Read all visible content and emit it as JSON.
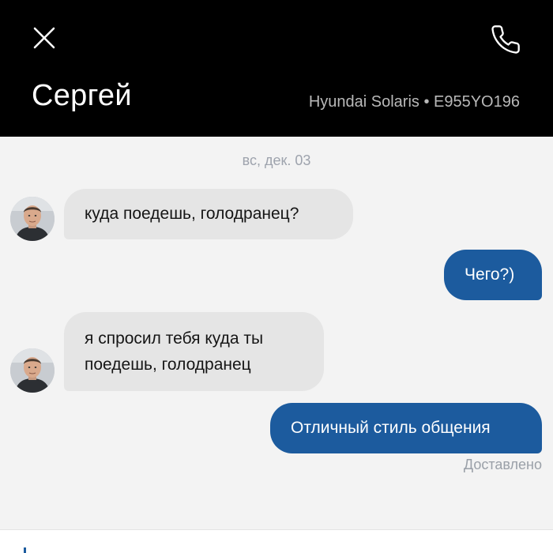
{
  "header": {
    "driver_name": "Сергей",
    "car_info": "Hyundai Solaris • E955YO196",
    "close_icon": "close-icon",
    "call_icon": "phone-icon"
  },
  "chat": {
    "date": "вс, дек. 03",
    "messages": [
      {
        "direction": "incoming",
        "text": "куда поедешь, голодранец?"
      },
      {
        "direction": "outgoing",
        "text": "Чего?)"
      },
      {
        "direction": "incoming",
        "text_lines": [
          "я спросил тебя куда ты",
          "поедешь, голодранец"
        ]
      },
      {
        "direction": "outgoing",
        "text": "Отличный стиль общения"
      }
    ],
    "status": "Доставлено"
  },
  "colors": {
    "header_bg": "#000000",
    "incoming_bubble": "#e5e5e5",
    "outgoing_bubble": "#1c5b9e",
    "chat_bg": "#f3f3f3"
  }
}
